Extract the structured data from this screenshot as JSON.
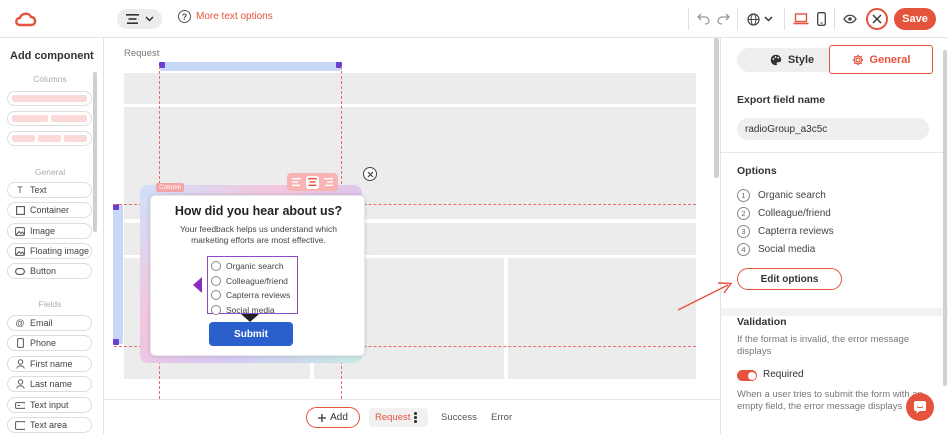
{
  "topbar": {
    "more_text_options": "More text options",
    "save_label": "Save",
    "brand_color": "#e5533c"
  },
  "left_panel": {
    "title": "Add component",
    "sections": {
      "columns": "Columns",
      "general": "General",
      "fields": "Fields"
    },
    "general_items": [
      {
        "label": "Text",
        "icon": "text-t-icon"
      },
      {
        "label": "Container",
        "icon": "square-icon"
      },
      {
        "label": "Image",
        "icon": "image-icon"
      },
      {
        "label": "Floating image",
        "icon": "floating-image-icon"
      },
      {
        "label": "Button",
        "icon": "button-pill-icon"
      }
    ],
    "field_items": [
      {
        "label": "Email",
        "icon": "at-icon"
      },
      {
        "label": "Phone",
        "icon": "phone-icon"
      },
      {
        "label": "First name",
        "icon": "person-icon"
      },
      {
        "label": "Last name",
        "icon": "person-icon"
      },
      {
        "label": "Text input",
        "icon": "text-input-icon"
      },
      {
        "label": "Text area",
        "icon": "text-area-icon"
      }
    ]
  },
  "canvas": {
    "request_label": "Request",
    "column_tag": "Column",
    "form": {
      "title": "How did you hear about us?",
      "description": "Your feedback helps us understand which marketing efforts are most effective.",
      "options": [
        "Organic search",
        "Colleague/friend",
        "Capterra reviews",
        "Social media"
      ],
      "submit_label": "Submit"
    }
  },
  "bottombar": {
    "add_label": "Add",
    "tabs": {
      "request": "Request",
      "success": "Success",
      "error": "Error"
    }
  },
  "right_panel": {
    "tabs": {
      "style": "Style",
      "general": "General"
    },
    "active_tab": "General",
    "export_heading": "Export field name",
    "export_value": "radioGroup_a3c5c",
    "options_heading": "Options",
    "options": [
      {
        "num": "1",
        "label": "Organic search"
      },
      {
        "num": "2",
        "label": "Colleague/friend"
      },
      {
        "num": "3",
        "label": "Capterra reviews"
      },
      {
        "num": "4",
        "label": "Social media"
      }
    ],
    "edit_options_label": "Edit options",
    "validation_heading": "Validation",
    "validation_text": "If the format is invalid, the error message displays",
    "required_label": "Required",
    "required_on": true,
    "required_text": "When a user tries to submit the form with an empty field, the error message displays"
  }
}
